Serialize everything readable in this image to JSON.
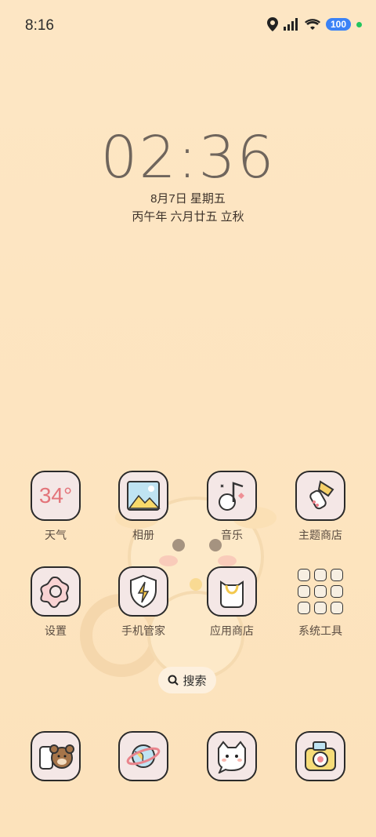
{
  "status_bar": {
    "time": "8:16",
    "battery": "100",
    "icons": [
      "location-icon",
      "signal-icon",
      "wifi-icon",
      "battery-icon",
      "active-dot-icon"
    ]
  },
  "lockscreen": {
    "clock": "02:36",
    "date": "8月7日 星期五",
    "lunar": "丙午年 六月廿五 立秋"
  },
  "apps_row1": [
    {
      "label": "天气",
      "temp": "34°",
      "icon": "weather-icon"
    },
    {
      "label": "相册",
      "icon": "gallery-icon"
    },
    {
      "label": "音乐",
      "icon": "music-icon"
    },
    {
      "label": "主题商店",
      "icon": "theme-store-icon"
    }
  ],
  "apps_row2": [
    {
      "label": "设置",
      "icon": "settings-icon"
    },
    {
      "label": "手机管家",
      "icon": "security-icon"
    },
    {
      "label": "应用商店",
      "icon": "app-store-icon"
    },
    {
      "label": "系统工具",
      "icon": "system-tools-folder-icon"
    }
  ],
  "search": {
    "label": "搜索"
  },
  "dock": [
    {
      "icon": "phone-icon"
    },
    {
      "icon": "browser-icon"
    },
    {
      "icon": "messages-icon"
    },
    {
      "icon": "camera-icon"
    }
  ]
}
